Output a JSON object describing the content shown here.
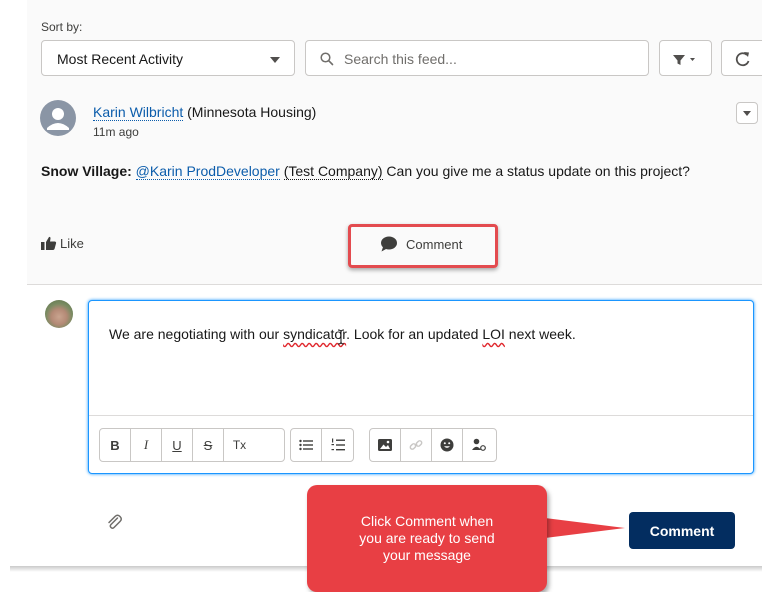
{
  "feed": {
    "sort_label": "Sort by:",
    "sort_value": "Most Recent Activity",
    "search_placeholder": "Search this feed..."
  },
  "post": {
    "author": "Karin Wilbricht",
    "author_org": "(Minnesota Housing)",
    "time": "11m ago",
    "record": "Snow Village:",
    "mention": "@Karin ProdDeveloper",
    "mention_org": "(Test Company)",
    "message": "Can you give me a status update on this project?",
    "like_label": "Like",
    "comment_label": "Comment"
  },
  "composer": {
    "text_before": "We are negotiating with our ",
    "word_flagged_1": "syndicator",
    "text_middle": ". Look for an updated ",
    "word_flagged_2": "LOI",
    "text_after": " next week.",
    "toolbar": {
      "bold": "B",
      "italic": "I",
      "underline": "U",
      "strike": "S",
      "clear_format": "Tx"
    },
    "submit_label": "Comment"
  },
  "tooltip": {
    "line1": "Click Comment when",
    "line2": "you are ready to send",
    "line3": "your message"
  },
  "colors": {
    "brand_dark": "#032d60",
    "link": "#0b5cab",
    "callout_red": "#e83f44",
    "focus_blue": "#1b96ff"
  }
}
